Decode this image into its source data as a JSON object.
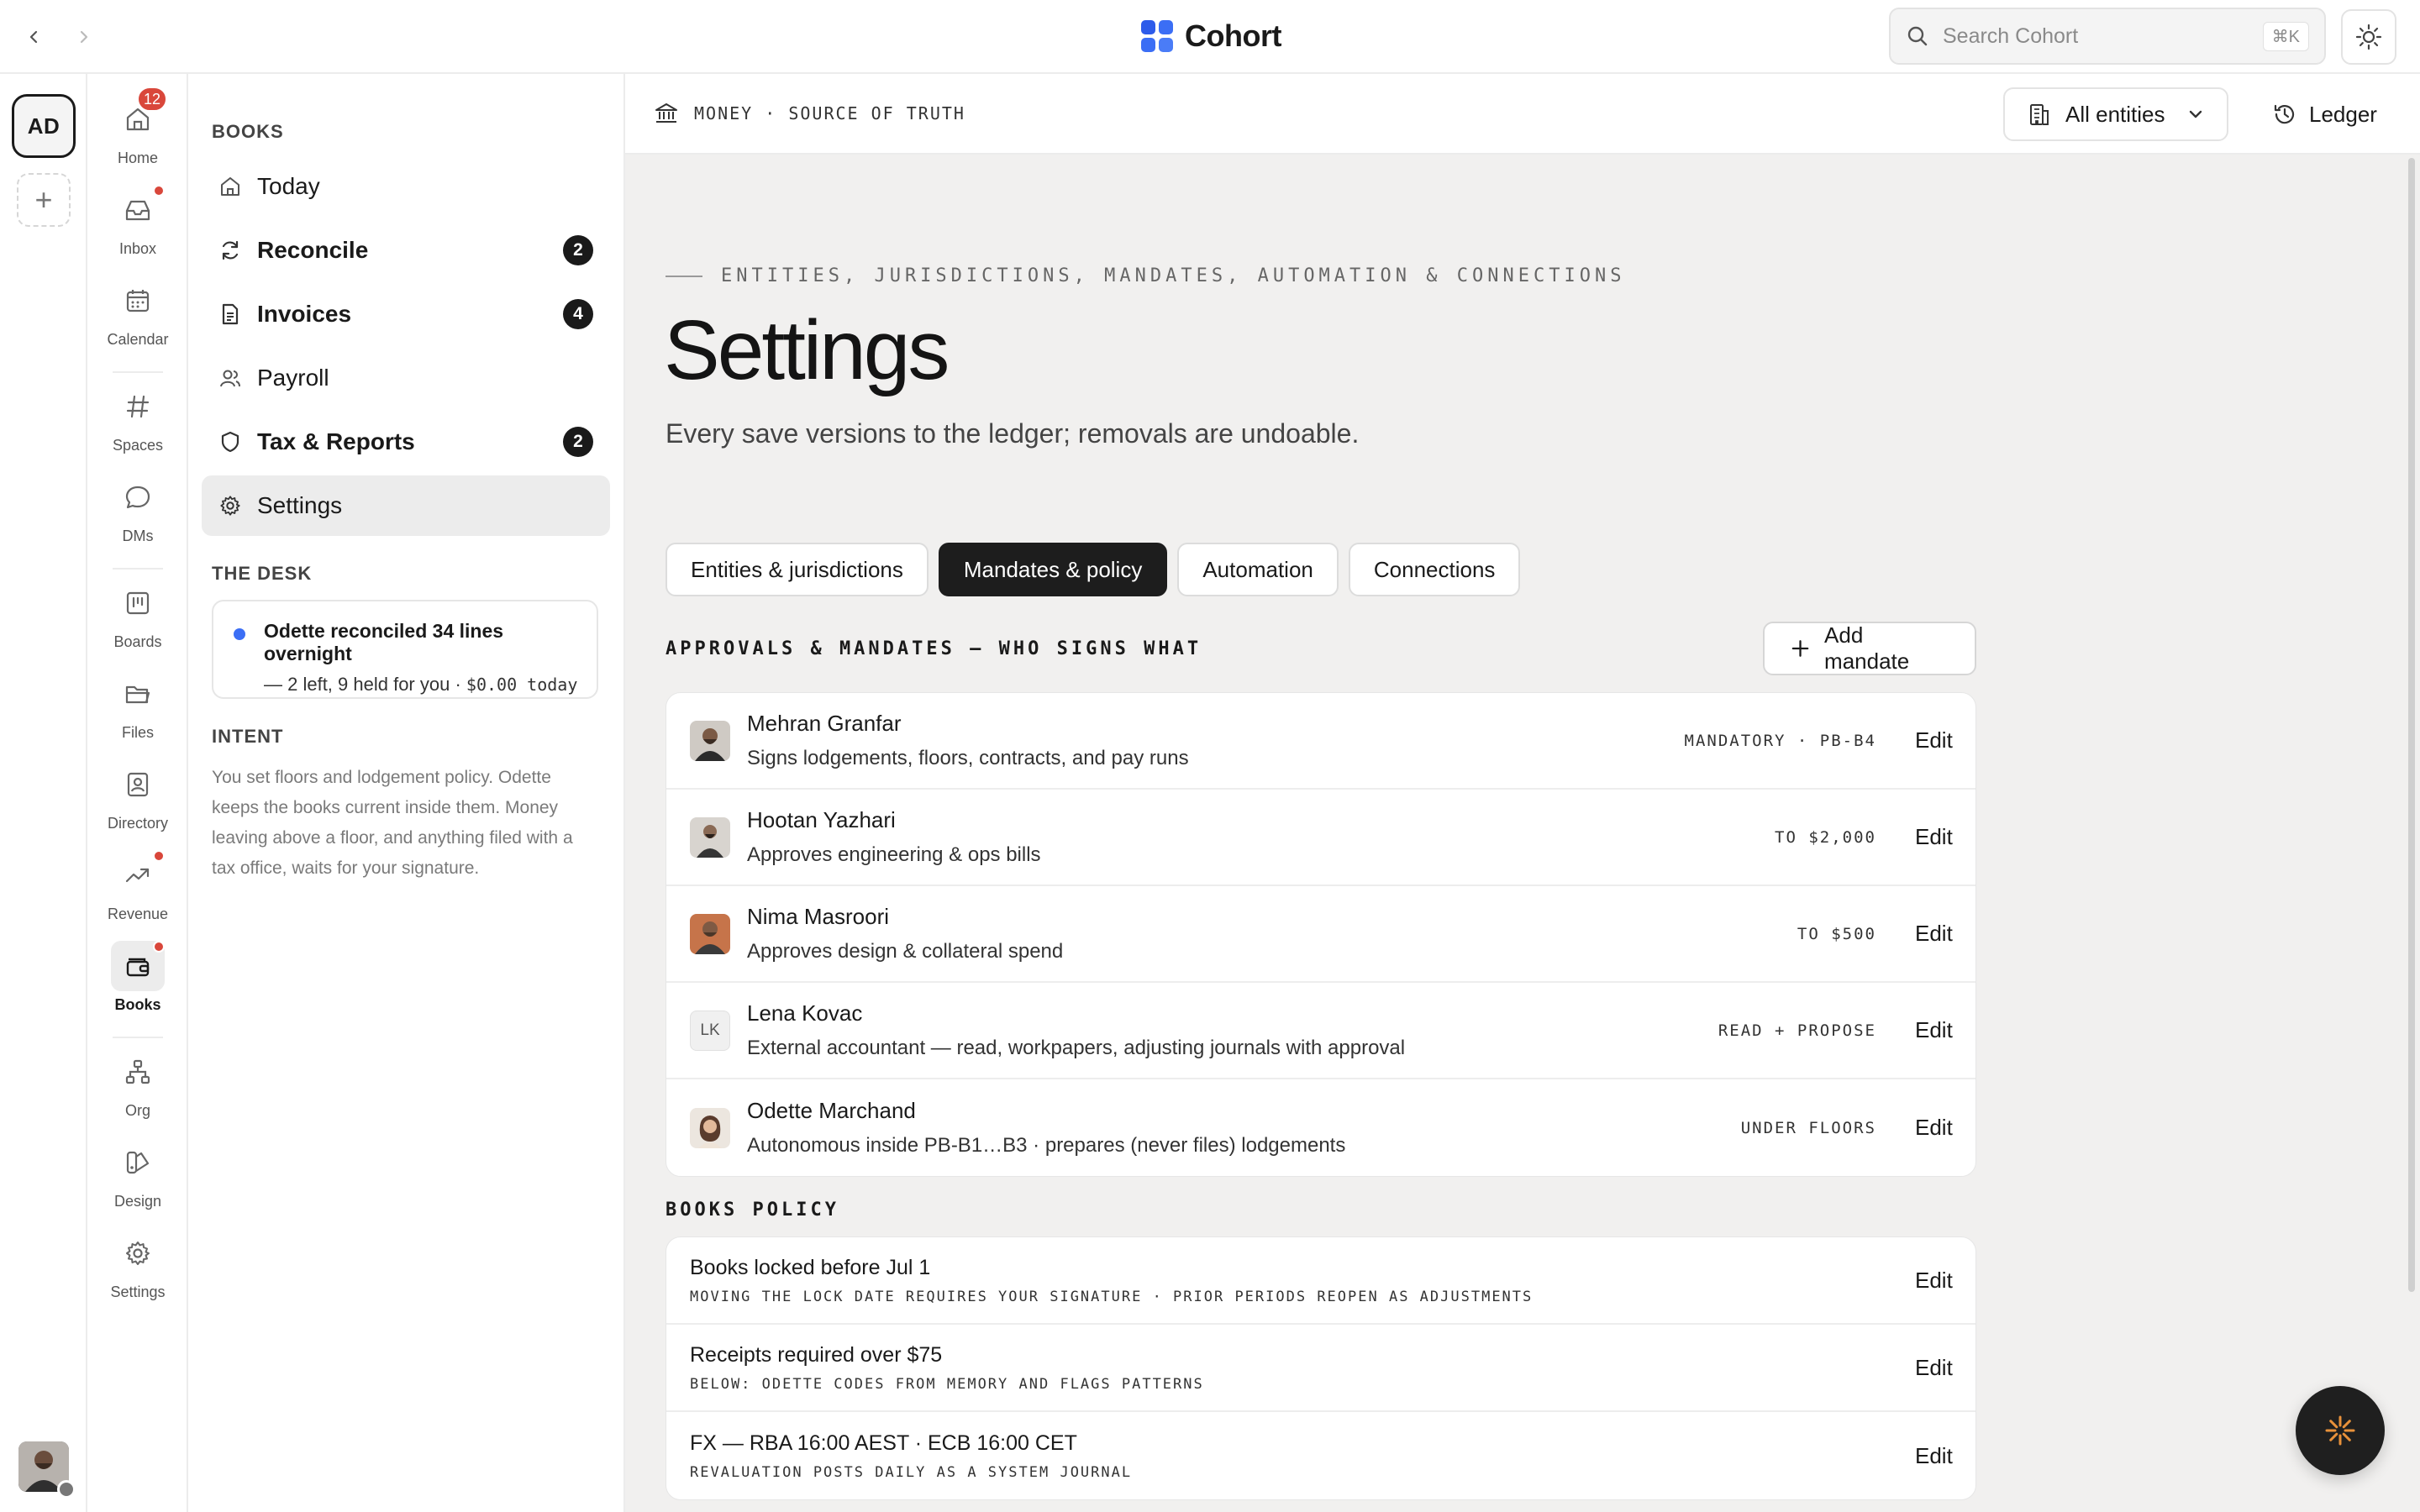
{
  "brand": {
    "name": "Cohort",
    "logo_colors": [
      "#2d5bea",
      "#3b6ef5",
      "#3b6ef5",
      "#4a7cf7"
    ]
  },
  "search": {
    "placeholder": "Search Cohort",
    "shortcut": "⌘K"
  },
  "workspace": {
    "initials": "AD",
    "add_label": "+"
  },
  "apps": [
    {
      "name": "home",
      "label": "Home",
      "badge": "12"
    },
    {
      "name": "inbox",
      "label": "Inbox",
      "dot": true
    },
    {
      "name": "calendar",
      "label": "Calendar"
    },
    {
      "name": "spaces",
      "label": "Spaces"
    },
    {
      "name": "dms",
      "label": "DMs"
    },
    {
      "name": "boards",
      "label": "Boards"
    },
    {
      "name": "files",
      "label": "Files"
    },
    {
      "name": "directory",
      "label": "Directory"
    },
    {
      "name": "revenue",
      "label": "Revenue",
      "dot": true
    },
    {
      "name": "books",
      "label": "Books",
      "dot": true,
      "active": true
    },
    {
      "name": "org",
      "label": "Org"
    },
    {
      "name": "design",
      "label": "Design"
    },
    {
      "name": "settings",
      "label": "Settings"
    }
  ],
  "sidebar": {
    "heading": "BOOKS",
    "items": [
      {
        "label": "Today",
        "icon": "home-icon"
      },
      {
        "label": "Reconcile",
        "icon": "refresh-icon",
        "count": "2"
      },
      {
        "label": "Invoices",
        "icon": "document-icon",
        "count": "4"
      },
      {
        "label": "Payroll",
        "icon": "people-icon"
      },
      {
        "label": "Tax & Reports",
        "icon": "shield-icon",
        "count": "2"
      },
      {
        "label": "Settings",
        "icon": "gear-icon",
        "active": true
      }
    ],
    "desk_heading": "THE DESK",
    "desk": {
      "title": "Odette reconciled 34 lines overnight",
      "sub": "— 2 left, 9 held for you · ",
      "amount": "$0.00 today"
    },
    "intent_heading": "INTENT",
    "intent": "You set floors and lodgement policy. Odette keeps the books current inside them. Money leaving above a floor, and anything filed with a tax office, waits for your signature."
  },
  "header": {
    "breadcrumb": "MONEY · SOURCE OF TRUTH",
    "entities_label": "All entities",
    "ledger_label": "Ledger"
  },
  "page": {
    "eyebrow": "ENTITIES, JURISDICTIONS, MANDATES, AUTOMATION & CONNECTIONS",
    "title": "Settings",
    "subtitle": "Every save versions to the ledger; removals are undoable."
  },
  "tabs": [
    {
      "label": "Entities & jurisdictions"
    },
    {
      "label": "Mandates & policy",
      "active": true
    },
    {
      "label": "Automation"
    },
    {
      "label": "Connections"
    }
  ],
  "mandates": {
    "heading": "APPROVALS & MANDATES — WHO SIGNS WHAT",
    "add_label": "Add mandate",
    "edit_label": "Edit",
    "rows": [
      {
        "name": "Mehran Granfar",
        "desc": "Signs lodgements, floors, contracts, and pay runs",
        "scope": "MANDATORY · PB-B4"
      },
      {
        "name": "Hootan Yazhari",
        "desc": "Approves engineering & ops bills",
        "scope": "TO $2,000"
      },
      {
        "name": "Nima Masroori",
        "desc": "Approves design & collateral spend",
        "scope": "TO $500"
      },
      {
        "name": "Lena Kovac",
        "initials": "LK",
        "desc": "External accountant — read, workpapers, adjusting journals with approval",
        "scope": "READ + PROPOSE"
      },
      {
        "name": "Odette Marchand",
        "desc": "Autonomous inside PB-B1…B3 · prepares (never files) lodgements",
        "scope": "UNDER FLOORS"
      }
    ]
  },
  "policy": {
    "heading": "BOOKS POLICY",
    "rows": [
      {
        "name": "Books locked before Jul 1",
        "note": "MOVING THE LOCK DATE REQUIRES YOUR SIGNATURE · PRIOR PERIODS REOPEN AS ADJUSTMENTS"
      },
      {
        "name": "Receipts required over $75",
        "note": "BELOW: ODETTE CODES FROM MEMORY AND FLAGS PATTERNS"
      },
      {
        "name": "FX — RBA 16:00 AEST · ECB 16:00 CET",
        "note": "REVALUATION POSTS DAILY AS A SYSTEM JOURNAL"
      }
    ]
  },
  "colors": {
    "accent": "#3b6ef5",
    "alert": "#d9473b",
    "fab_spark": "#e8913a"
  }
}
